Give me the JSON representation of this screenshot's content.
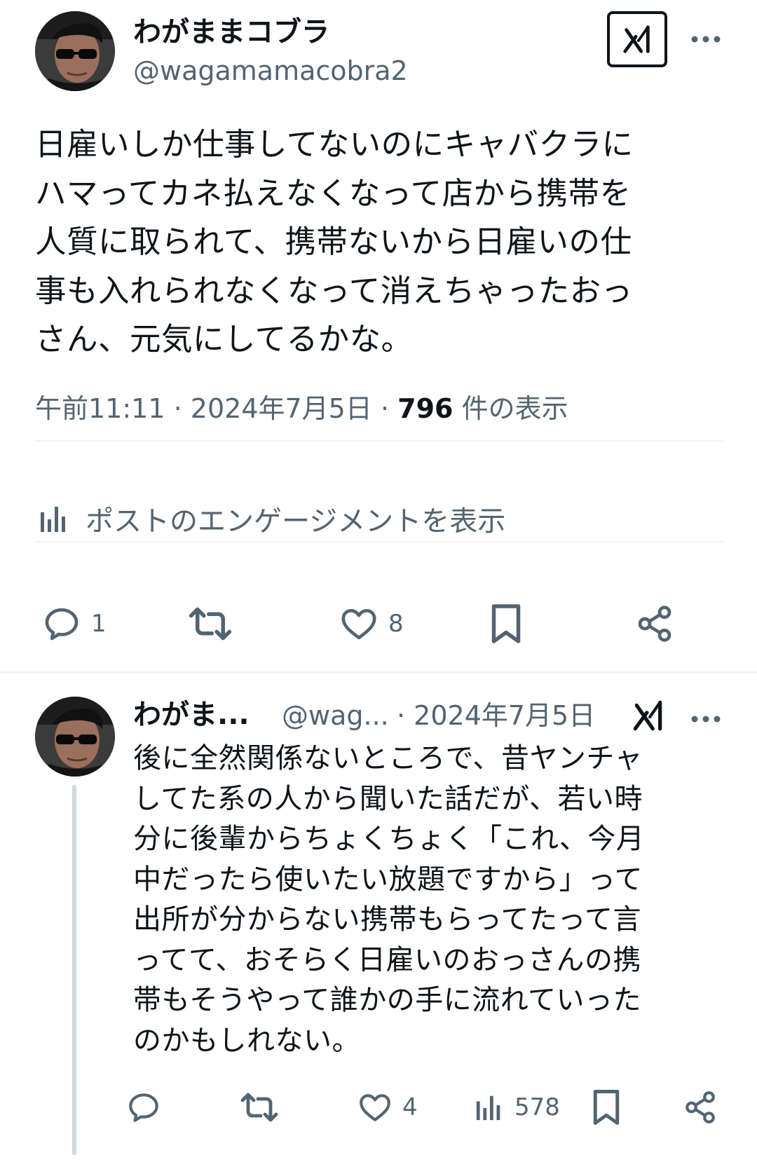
{
  "main_post": {
    "display_name": "わがままコブラ",
    "handle": "@wagamamacobra2",
    "avatar_icon": "profile-photo-man-sunglasses",
    "grok_icon": "grok-icon",
    "more_icon": "more-icon",
    "text_lines": [
      "日雇いしか仕事してないのにキャバクラに",
      "ハマってカネ払えなくなって店から携帯を",
      "人質に取られて、携帯ないから日雇いの仕",
      "事も入れられなくなって消えちゃったおっ",
      "さん、元気にしてるかな。"
    ],
    "time": "午前11:11",
    "date": "2024年7月5日",
    "separator": "·",
    "views_count": "796",
    "views_label": "件の表示",
    "engagement_link": "ポストのエンゲージメントを表示",
    "actions": {
      "reply_count": "1",
      "repost_count": "",
      "like_count": "8"
    }
  },
  "reply": {
    "display_name": "わがま...",
    "handle": "@wag...",
    "date": "· 2024年7月5日",
    "text_lines": [
      "後に全然関係ないところで、昔ヤンチャ",
      "してた系の人から聞いた話だが、若い時",
      "分に後輩からちょくちょく「これ、今月",
      "中だったら使いたい放題ですから」って",
      "出所が分からない携帯もらってたって言",
      "ってて、おそらく日雇いのおっさんの携",
      "帯もそうやって誰かの手に流れていった",
      "のかもしれない。"
    ],
    "actions": {
      "reply_count": "",
      "repost_count": "",
      "like_count": "4",
      "views_count": "578"
    }
  },
  "colors": {
    "text_primary": "#0f1419",
    "text_secondary": "#536471",
    "divider": "#eff3f4",
    "thread_line": "#cfd9de"
  }
}
